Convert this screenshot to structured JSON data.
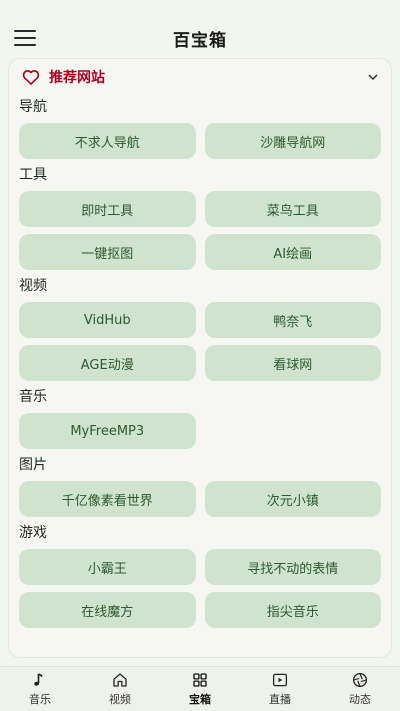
{
  "header": {
    "title": "百宝箱"
  },
  "card": {
    "title": "推荐网站",
    "sections": [
      {
        "label": "导航",
        "rows": [
          [
            "不求人导航",
            "沙雕导航网"
          ]
        ]
      },
      {
        "label": "工具",
        "rows": [
          [
            "即时工具",
            "菜鸟工具"
          ],
          [
            "一键抠图",
            "AI绘画"
          ]
        ]
      },
      {
        "label": "视频",
        "rows": [
          [
            "VidHub",
            "鸭奈飞"
          ],
          [
            "AGE动漫",
            "看球网"
          ]
        ]
      },
      {
        "label": "音乐",
        "rows": [
          [
            "MyFreeMP3",
            ""
          ]
        ]
      },
      {
        "label": "图片",
        "rows": [
          [
            "千亿像素看世界",
            "次元小镇"
          ]
        ]
      },
      {
        "label": "游戏",
        "rows": [
          [
            "小霸王",
            "寻找不动的表情"
          ],
          [
            "在线魔方",
            "指尖音乐"
          ]
        ]
      }
    ]
  },
  "bottom_nav": {
    "items": [
      {
        "label": "音乐",
        "icon": "music-note-icon"
      },
      {
        "label": "视频",
        "icon": "home-icon"
      },
      {
        "label": "宝箱",
        "icon": "grid-icon",
        "active": true
      },
      {
        "label": "直播",
        "icon": "play-box-icon"
      },
      {
        "label": "动态",
        "icon": "aperture-icon"
      }
    ]
  }
}
